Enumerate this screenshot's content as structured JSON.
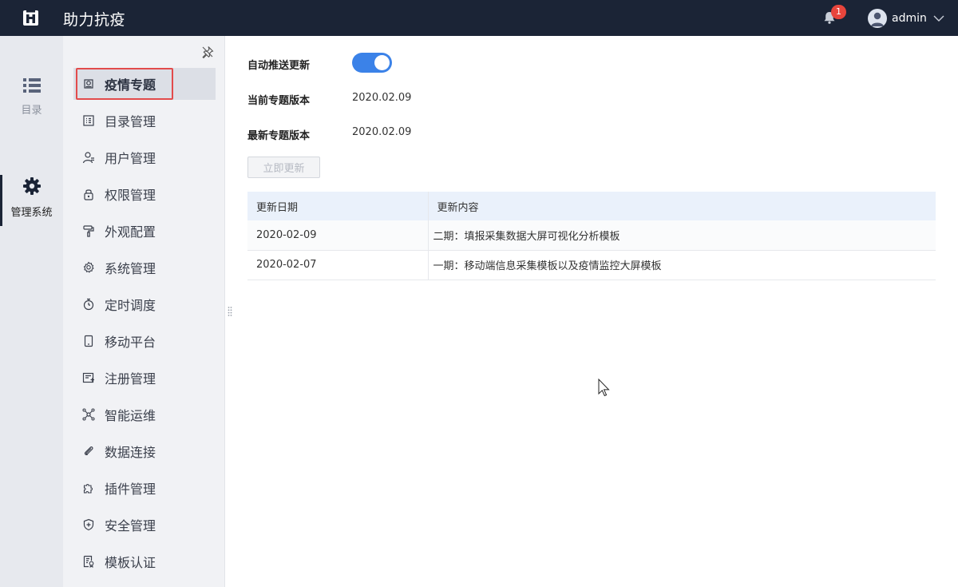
{
  "header": {
    "app_title": "助力抗疫",
    "notification_count": "1",
    "username": "admin"
  },
  "rail": {
    "items": [
      {
        "label": "目录",
        "icon": "list-icon"
      },
      {
        "label": "管理系统",
        "icon": "gear-icon"
      }
    ]
  },
  "sidebar": {
    "items": [
      {
        "label": "疫情专题",
        "icon": "dashboard-icon"
      },
      {
        "label": "目录管理",
        "icon": "catalog-icon"
      },
      {
        "label": "用户管理",
        "icon": "user-icon"
      },
      {
        "label": "权限管理",
        "icon": "lock-icon"
      },
      {
        "label": "外观配置",
        "icon": "paint-roller-icon"
      },
      {
        "label": "系统管理",
        "icon": "cog-icon"
      },
      {
        "label": "定时调度",
        "icon": "stopwatch-icon"
      },
      {
        "label": "移动平台",
        "icon": "mobile-icon"
      },
      {
        "label": "注册管理",
        "icon": "register-icon"
      },
      {
        "label": "智能运维",
        "icon": "network-icon"
      },
      {
        "label": "数据连接",
        "icon": "paperclip-icon"
      },
      {
        "label": "插件管理",
        "icon": "puzzle-icon"
      },
      {
        "label": "安全管理",
        "icon": "shield-icon"
      },
      {
        "label": "模板认证",
        "icon": "certificate-icon"
      }
    ]
  },
  "main": {
    "auto_push_label": "自动推送更新",
    "auto_push_enabled": true,
    "current_version_label": "当前专题版本",
    "current_version": "2020.02.09",
    "latest_version_label": "最新专题版本",
    "latest_version": "2020.02.09",
    "update_button": "立即更新",
    "table": {
      "headers": [
        "更新日期",
        "更新内容"
      ],
      "rows": [
        [
          "2020-02-09",
          "二期：填报采集数据大屏可视化分析模板"
        ],
        [
          "2020-02-07",
          "一期：移动端信息采集模板以及疫情监控大屏模板"
        ]
      ]
    }
  },
  "colors": {
    "topbar": "#1b2436",
    "accent": "#3b82e8",
    "highlight": "#e24b4b",
    "badge": "#e8453c"
  }
}
